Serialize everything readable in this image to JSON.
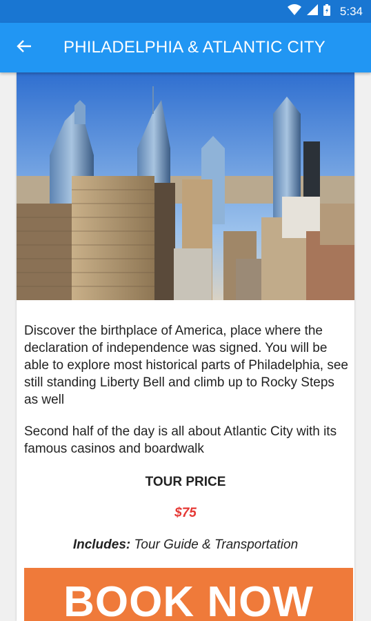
{
  "status_bar": {
    "time": "5:34"
  },
  "app_bar": {
    "title": "PHILADELPHIA & ATLANTIC CITY"
  },
  "tour": {
    "description_1": "Discover the birthplace of America, place where the declaration of independence was signed. You will be able to explore most historical parts of Philadelphia, see still standing Liberty Bell and climb up to Rocky Steps as well",
    "description_2": "Second half of the day is all about Atlantic City with its famous casinos and boardwalk",
    "price_heading": "TOUR PRICE",
    "price": "$75",
    "includes_label": "Includes:",
    "includes_value": "Tour Guide & Transportation",
    "book_label": "BOOK NOW"
  },
  "colors": {
    "status_bar": "#1976d2",
    "app_bar": "#2196f3",
    "price": "#e53935",
    "book_button": "#ef7a3a"
  }
}
